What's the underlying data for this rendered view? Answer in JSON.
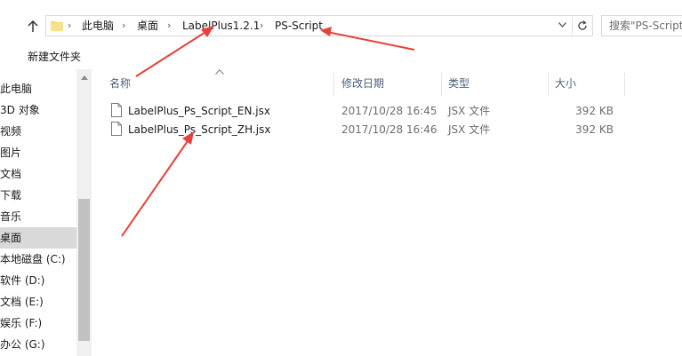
{
  "address_bar": {
    "breadcrumbs": [
      "此电脑",
      "桌面",
      "LabelPlus1.2.1",
      "PS-Script"
    ],
    "separator": "›",
    "dropdown_icon": "chevron-down-icon",
    "refresh_icon": "refresh-icon"
  },
  "search": {
    "placeholder": "搜索\"PS-Script\""
  },
  "toolbar": {
    "new_folder_label": "新建文件夹"
  },
  "sidebar": {
    "items": [
      {
        "label": "此电脑"
      },
      {
        "label": "3D 对象"
      },
      {
        "label": "视频"
      },
      {
        "label": "图片"
      },
      {
        "label": "文档"
      },
      {
        "label": "下载"
      },
      {
        "label": "音乐"
      },
      {
        "label": "桌面"
      },
      {
        "label": "本地磁盘 (C:)"
      },
      {
        "label": "软件 (D:)"
      },
      {
        "label": "文档 (E:)"
      },
      {
        "label": "娱乐 (F:)"
      },
      {
        "label": "办公 (G:)"
      }
    ],
    "selected": "桌面"
  },
  "file_list": {
    "columns": [
      "名称",
      "修改日期",
      "类型",
      "大小"
    ],
    "files": [
      {
        "name": "LabelPlus_Ps_Script_EN.jsx",
        "modified": "2017/10/28 16:45",
        "type": "JSX 文件",
        "size": "392 KB"
      },
      {
        "name": "LabelPlus_Ps_Script_ZH.jsx",
        "modified": "2017/10/28 16:46",
        "type": "JSX 文件",
        "size": "392 KB"
      }
    ]
  },
  "colors": {
    "annotation_arrow": "#e8413b",
    "header_text": "#4c607a",
    "selected_bg": "#d9d9d9"
  }
}
